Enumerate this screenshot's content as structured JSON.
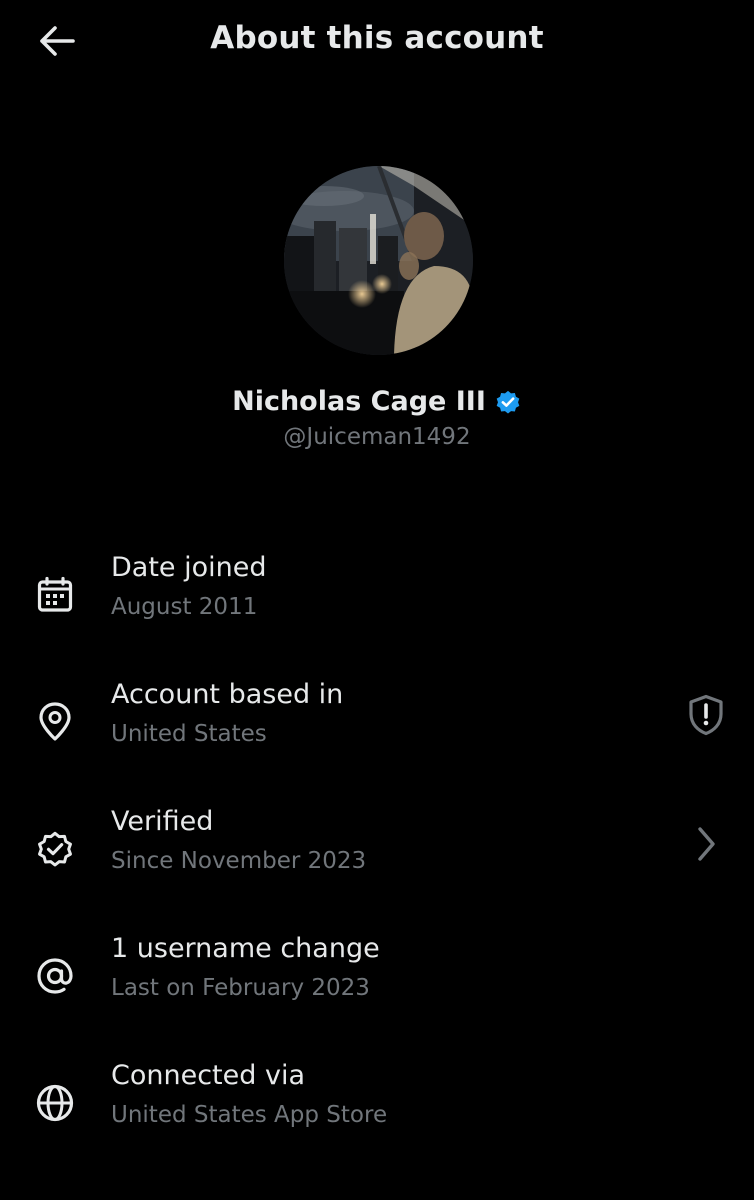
{
  "header": {
    "title": "About this account",
    "back_icon": "arrow-left-icon"
  },
  "profile": {
    "name": "Nicholas Cage III",
    "handle": "@Juiceman1492",
    "verified": true,
    "verified_color": "#1d9bf0"
  },
  "rows": [
    {
      "icon": "calendar-icon",
      "title": "Date joined",
      "subtitle": "August 2011"
    },
    {
      "icon": "location-pin-icon",
      "title": "Account based in",
      "subtitle": "United States",
      "right_icon": "shield-alert-icon"
    },
    {
      "icon": "verified-badge-icon",
      "title": "Verified",
      "subtitle": "Since November 2023",
      "right_icon": "chevron-right-icon"
    },
    {
      "icon": "at-sign-icon",
      "title": "1 username change",
      "subtitle": "Last on February 2023"
    },
    {
      "icon": "globe-icon",
      "title": "Connected via",
      "subtitle": "United States App Store"
    }
  ],
  "colors": {
    "background": "#000000",
    "primary_text": "#e7e9ea",
    "secondary_text": "#71767b"
  }
}
